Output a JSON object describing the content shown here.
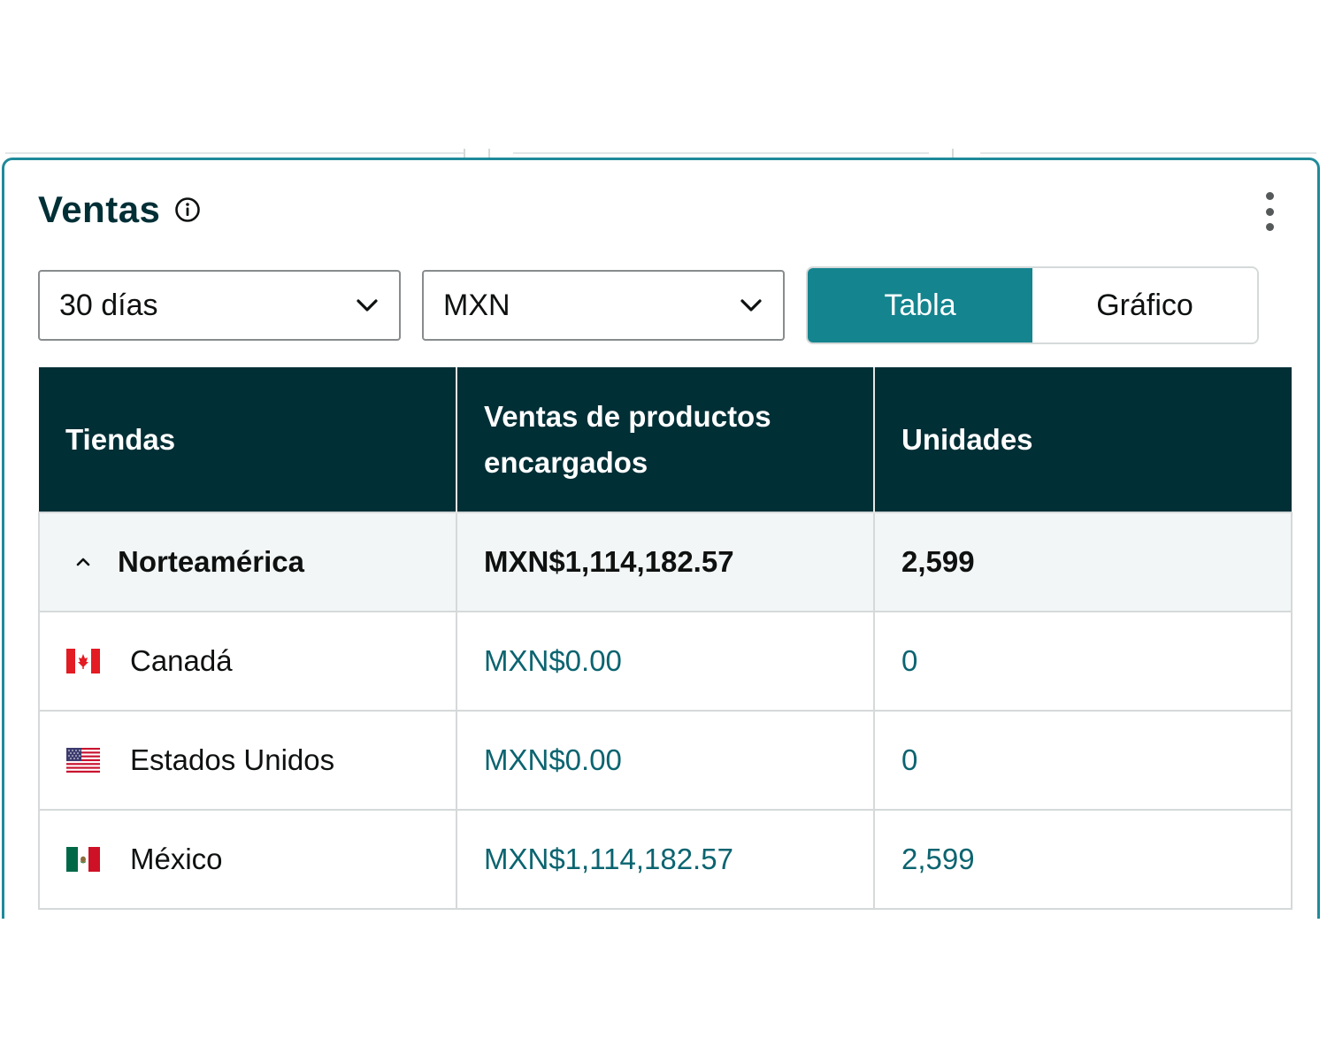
{
  "card": {
    "title": "Ventas",
    "info_icon": "info-circle-icon",
    "menu_icon": "kebab-menu-icon"
  },
  "filters": {
    "period": {
      "selected": "30 días",
      "icon": "chevron-down-icon"
    },
    "currency": {
      "selected": "MXN",
      "icon": "chevron-down-icon"
    }
  },
  "view_toggle": {
    "options": [
      {
        "label": "Tabla",
        "active": true
      },
      {
        "label": "Gráfico",
        "active": false
      }
    ]
  },
  "table": {
    "headers": [
      "Tiendas",
      "Ventas de productos encargados",
      "Unidades"
    ],
    "group": {
      "name": "Norteamérica",
      "sales": "MXN$1,114,182.57",
      "units": "2,599",
      "icon": "chevron-up-icon"
    },
    "rows": [
      {
        "store": "Canadá",
        "flag": "canada-flag-icon",
        "sales": "MXN$0.00",
        "units": "0"
      },
      {
        "store": "Estados Unidos",
        "flag": "usa-flag-icon",
        "sales": "MXN$0.00",
        "units": "0"
      },
      {
        "store": "México",
        "flag": "mexico-flag-icon",
        "sales": "MXN$1,114,182.57",
        "units": "2,599"
      }
    ]
  },
  "colors": {
    "card_border": "#1f8a9a",
    "header_bg": "#002f36",
    "toggle_active": "#14848f",
    "link_value": "#0b6470",
    "group_row_bg": "#f3f6f6"
  }
}
